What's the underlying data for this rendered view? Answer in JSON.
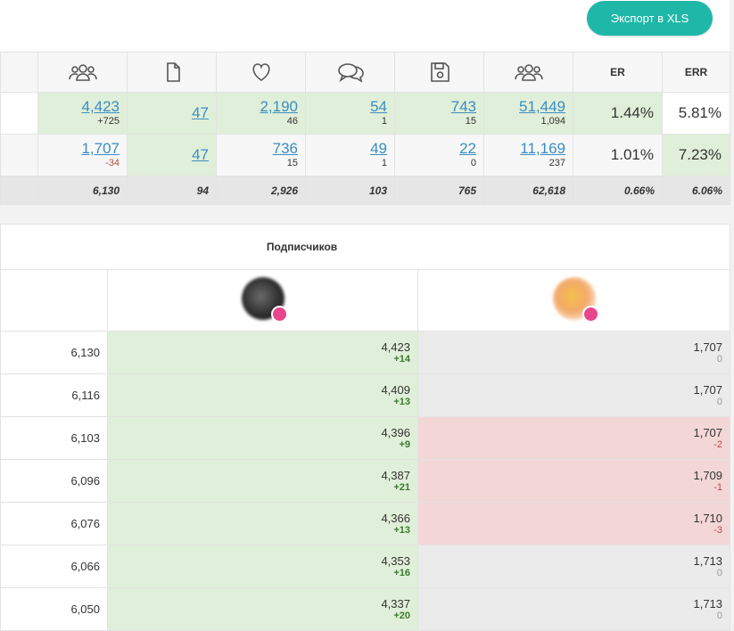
{
  "toolbar": {
    "export_label": "Экспорт в XLS"
  },
  "stats": {
    "columns": [
      {
        "icon": "users-icon"
      },
      {
        "icon": "document-icon"
      },
      {
        "icon": "heart-icon"
      },
      {
        "icon": "comments-icon"
      },
      {
        "icon": "save-icon"
      },
      {
        "icon": "users-icon"
      },
      {
        "label": "ER"
      },
      {
        "label": "ERR"
      }
    ],
    "rows": [
      {
        "subscribers": {
          "main": "4,423",
          "sub": "+725"
        },
        "posts": {
          "main": "47"
        },
        "likes": {
          "main": "2,190",
          "sub": "46"
        },
        "comments": {
          "main": "54",
          "sub": "1"
        },
        "saves": {
          "main": "743",
          "sub": "15"
        },
        "reach": {
          "main": "51,449",
          "sub": "1,094"
        },
        "er": "1.44%",
        "err": "5.81%"
      },
      {
        "subscribers": {
          "main": "1,707",
          "sub": "-34"
        },
        "posts": {
          "main": "47"
        },
        "likes": {
          "main": "736",
          "sub": "15"
        },
        "comments": {
          "main": "49",
          "sub": "1"
        },
        "saves": {
          "main": "22",
          "sub": "0"
        },
        "reach": {
          "main": "11,169",
          "sub": "237"
        },
        "er": "1.01%",
        "err": "7.23%"
      }
    ],
    "totals": [
      "6,130",
      "94",
      "2,926",
      "103",
      "765",
      "62,618",
      "0.66%",
      "6.06%"
    ]
  },
  "subscribers_table": {
    "title": "Подписчиков",
    "rows": [
      {
        "total": "6,130",
        "a": {
          "v": "4,423",
          "d": "+14"
        },
        "b": {
          "v": "1,707",
          "d": "0"
        }
      },
      {
        "total": "6,116",
        "a": {
          "v": "4,409",
          "d": "+13"
        },
        "b": {
          "v": "1,707",
          "d": "0"
        }
      },
      {
        "total": "6,103",
        "a": {
          "v": "4,396",
          "d": "+9"
        },
        "b": {
          "v": "1,707",
          "d": "-2"
        }
      },
      {
        "total": "6,096",
        "a": {
          "v": "4,387",
          "d": "+21"
        },
        "b": {
          "v": "1,709",
          "d": "-1"
        }
      },
      {
        "total": "6,076",
        "a": {
          "v": "4,366",
          "d": "+13"
        },
        "b": {
          "v": "1,710",
          "d": "-3"
        }
      },
      {
        "total": "6,066",
        "a": {
          "v": "4,353",
          "d": "+16"
        },
        "b": {
          "v": "1,713",
          "d": "0"
        }
      },
      {
        "total": "6,050",
        "a": {
          "v": "4,337",
          "d": "+20"
        },
        "b": {
          "v": "1,713",
          "d": "0"
        }
      }
    ]
  },
  "colors": {
    "accent": "#1fb8a8",
    "positive_bg": "#e0efd9",
    "negative_bg": "#f2d7d6",
    "neutral_bg": "#ebebeb",
    "link": "#3a8dc3"
  }
}
